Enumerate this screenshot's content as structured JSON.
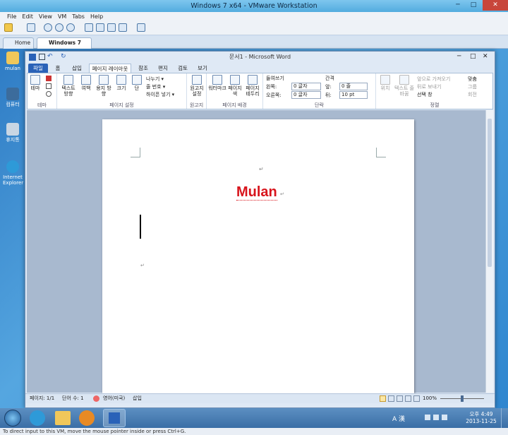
{
  "vm": {
    "title": "Windows 7 x64 - VMware Workstation",
    "menu": [
      "File",
      "Edit",
      "View",
      "VM",
      "Tabs",
      "Help"
    ],
    "tabs": [
      {
        "label": "Home"
      },
      {
        "label": "Windows 7 x64"
      }
    ],
    "status_hint": "To direct input to this VM, move the mouse pointer inside or press Ctrl+G."
  },
  "desktop": {
    "icons": [
      {
        "label": "mulan"
      },
      {
        "label": "컴퓨터"
      },
      {
        "label": "휴지통"
      },
      {
        "label": "Internet Explorer"
      }
    ]
  },
  "word": {
    "title": "문서1 - Microsoft Word",
    "tabs": [
      "파일",
      "홈",
      "삽입",
      "페이지 레이아웃",
      "참조",
      "편지",
      "검토",
      "보기"
    ],
    "ribbon": {
      "theme": {
        "label": "테마",
        "btn": "테마"
      },
      "page_setup": {
        "label": "페이지 설정",
        "buttons": [
          "텍스트 방향",
          "여백",
          "용지 방향",
          "크기",
          "단"
        ],
        "breaks": "나누기",
        "line_numbers": "줄 번호",
        "hyphen": "하이픈 넣기"
      },
      "manuscript": {
        "label": "원고지",
        "btn": "원고지 설정"
      },
      "background": {
        "label": "페이지 배경",
        "buttons": [
          "워터마크",
          "페이지 색",
          "페이지 테두리"
        ]
      },
      "paragraph": {
        "label": "단락",
        "indent": "들여쓰기",
        "left": "왼쪽:",
        "right": "오른쪽:",
        "left_val": "0 글자",
        "right_val": "0 글자",
        "spacing": "간격",
        "before": "앞:",
        "after": "뒤:",
        "before_val": "0 줄",
        "after_val": "10 pt"
      },
      "arrange": {
        "label": "정렬",
        "buttons": [
          "위치",
          "텍스트 줄 바꿈"
        ],
        "items": [
          "앞으로 가져오기",
          "뒤로 보내기",
          "선택 창",
          "맞춤",
          "그룹",
          "회전"
        ]
      }
    },
    "document": {
      "heading": "Mulan"
    },
    "status": {
      "page": "페이지: 1/1",
      "words": "단어 수: 1",
      "lang": "영어(미국)",
      "mode": "삽입",
      "zoom": "100%"
    }
  },
  "taskbar": {
    "ime": "A 漢",
    "time": "오후 4:49",
    "date": "2013-11-25"
  },
  "colors": {
    "accent": "#2a62b8",
    "heading": "#d8141c"
  }
}
